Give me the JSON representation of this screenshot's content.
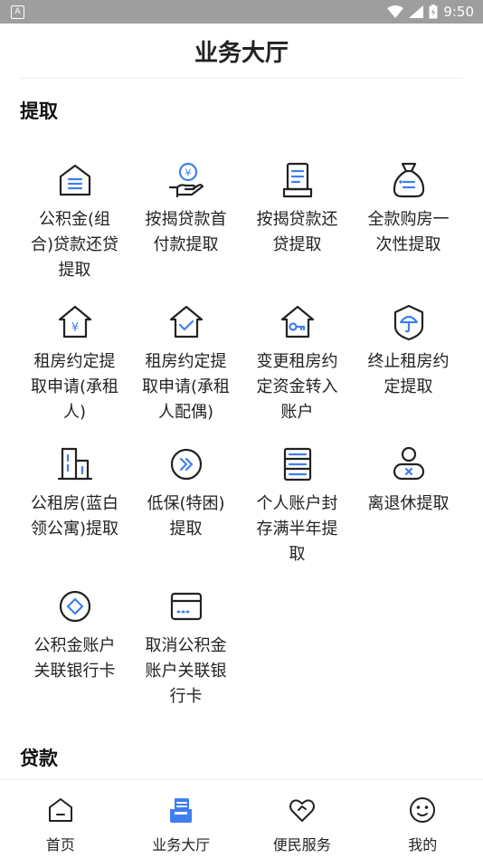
{
  "status_bar": {
    "left_badge": "A",
    "time": "9:50"
  },
  "header": {
    "title": "业务大厅"
  },
  "sections": [
    {
      "title": "提取",
      "items": [
        {
          "label": "公积金(组合)贷款还贷提取",
          "icon": "house-stack-icon"
        },
        {
          "label": "按揭贷款首付款提取",
          "icon": "hand-coin-icon"
        },
        {
          "label": "按揭贷款还贷提取",
          "icon": "receipt-icon"
        },
        {
          "label": "全款购房一次性提取",
          "icon": "money-bag-icon"
        },
        {
          "label": "租房约定提取申请(承租人)",
          "icon": "house-yen-icon"
        },
        {
          "label": "租房约定提取申请(承租人配偶)",
          "icon": "house-check-icon"
        },
        {
          "label": "变更租房约定资金转入账户",
          "icon": "house-key-icon"
        },
        {
          "label": "终止租房约定提取",
          "icon": "shield-umbrella-icon"
        },
        {
          "label": "公租房(蓝白领公寓)提取",
          "icon": "building-icon"
        },
        {
          "label": "低保(特困)提取",
          "icon": "double-chevron-icon"
        },
        {
          "label": "个人账户封存满半年提取",
          "icon": "server-stack-icon"
        },
        {
          "label": "离退休提取",
          "icon": "retiree-icon"
        },
        {
          "label": "公积金账户关联银行卡",
          "icon": "diamond-circle-icon"
        },
        {
          "label": "取消公积金账户关联银行卡",
          "icon": "bank-card-icon"
        }
      ]
    },
    {
      "title": "贷款"
    }
  ],
  "tabbar": [
    {
      "label": "首页",
      "icon": "home-icon",
      "active": false
    },
    {
      "label": "业务大厅",
      "icon": "service-hall-icon",
      "active": true
    },
    {
      "label": "便民服务",
      "icon": "heart-hands-icon",
      "active": false
    },
    {
      "label": "我的",
      "icon": "smiley-icon",
      "active": false
    }
  ],
  "colors": {
    "accent": "#3f7ff0",
    "status_bar": "#9e9e9e",
    "text": "#222222"
  }
}
